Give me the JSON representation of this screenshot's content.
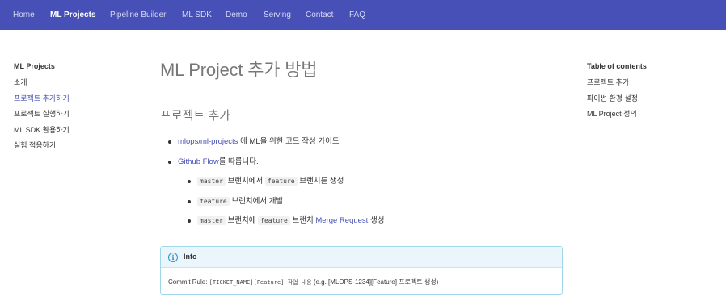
{
  "topnav": {
    "items": [
      {
        "label": "Home"
      },
      {
        "label": "ML Projects"
      },
      {
        "label": "Pipeline Builder"
      },
      {
        "label": "ML SDK"
      },
      {
        "label": "Demo"
      },
      {
        "label": "Serving"
      },
      {
        "label": "Contact"
      },
      {
        "label": "FAQ"
      }
    ],
    "active": "ML Projects"
  },
  "sidebar": {
    "title": "ML Projects",
    "items": [
      {
        "label": "소개"
      },
      {
        "label": "프로젝트 추가하기"
      },
      {
        "label": "프로젝트 실행하기"
      },
      {
        "label": "ML SDK 활용하기"
      },
      {
        "label": "실험 적용하기"
      }
    ],
    "active": "프로젝트 추가하기"
  },
  "toc": {
    "title": "Table of contents",
    "items": [
      {
        "label": "프로젝트 추가"
      },
      {
        "label": "파이썬 환경 설정"
      },
      {
        "label": "ML Project 정의"
      }
    ]
  },
  "main": {
    "title": "ML Project 추가 방법",
    "section_heading": "프로젝트 추가",
    "bullet1": {
      "link": "mlops/ml-projects",
      "text": " 에 ML을 위한 코드 작성 가이드"
    },
    "bullet2": {
      "link": "Github Flow",
      "text": "를 따릅니다."
    },
    "sub1": {
      "code1": "master",
      "t1": " 브랜치에서 ",
      "code2": "feature",
      "t2": " 브랜치를 생성"
    },
    "sub2": {
      "code1": "feature",
      "t1": " 브랜치에서 개발"
    },
    "sub3": {
      "code1": "master",
      "t1": " 브랜치에 ",
      "code2": "feature",
      "t2": " 브랜치 ",
      "link": "Merge Request",
      "t3": " 생성"
    }
  },
  "info": {
    "icon": "info-icon",
    "label": "Info",
    "rule_prefix": "Commit Rule: ",
    "rule_code": "[TICKET_NAME][Feature] 작업 내용",
    "rule_suffix": " (e.g. [MLOPS-1234][Feature] 프로젝트 생성)"
  },
  "colors": {
    "nav_bg": "#4750b6",
    "link": "#4750b6",
    "info_border": "#9fd6e8",
    "info_icon": "#2a8fc6"
  }
}
